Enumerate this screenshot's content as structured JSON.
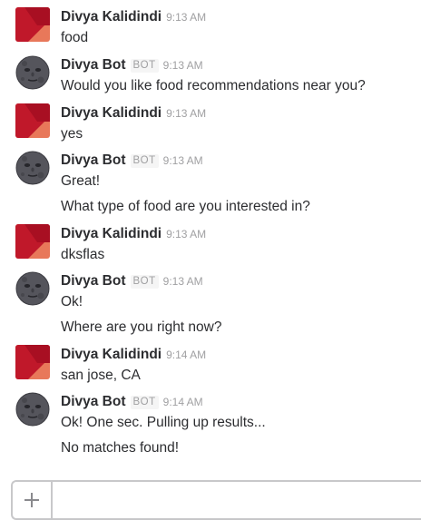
{
  "messages": [
    {
      "sender": "Divya Kalidindi",
      "is_bot": false,
      "time": "9:13 AM",
      "lines": [
        "food"
      ]
    },
    {
      "sender": "Divya Bot",
      "is_bot": true,
      "badge": "BOT",
      "time": "9:13 AM",
      "lines": [
        "Would you like food recommendations near you?"
      ]
    },
    {
      "sender": "Divya Kalidindi",
      "is_bot": false,
      "time": "9:13 AM",
      "lines": [
        "yes"
      ]
    },
    {
      "sender": "Divya Bot",
      "is_bot": true,
      "badge": "BOT",
      "time": "9:13 AM",
      "lines": [
        "Great!",
        "What type of food are you interested in?"
      ]
    },
    {
      "sender": "Divya Kalidindi",
      "is_bot": false,
      "time": "9:13 AM",
      "lines": [
        "dksflas"
      ]
    },
    {
      "sender": "Divya Bot",
      "is_bot": true,
      "badge": "BOT",
      "time": "9:13 AM",
      "lines": [
        "Ok!",
        "Where are you right now?"
      ]
    },
    {
      "sender": "Divya Kalidindi",
      "is_bot": false,
      "time": "9:14 AM",
      "lines": [
        "san jose, CA"
      ]
    },
    {
      "sender": "Divya Bot",
      "is_bot": true,
      "badge": "BOT",
      "time": "9:14 AM",
      "lines": [
        "Ok! One sec. Pulling up results...",
        "No matches found!"
      ]
    }
  ],
  "composer": {
    "plus_icon": "plus-icon",
    "input_value": "",
    "input_placeholder": ""
  },
  "colors": {
    "user_avatar_dark": "#c0182a",
    "user_avatar_light": "#e8785a",
    "badge_text": "#a0a0a2",
    "timestamp": "#a0a0a2",
    "border": "#c8c8ca"
  }
}
